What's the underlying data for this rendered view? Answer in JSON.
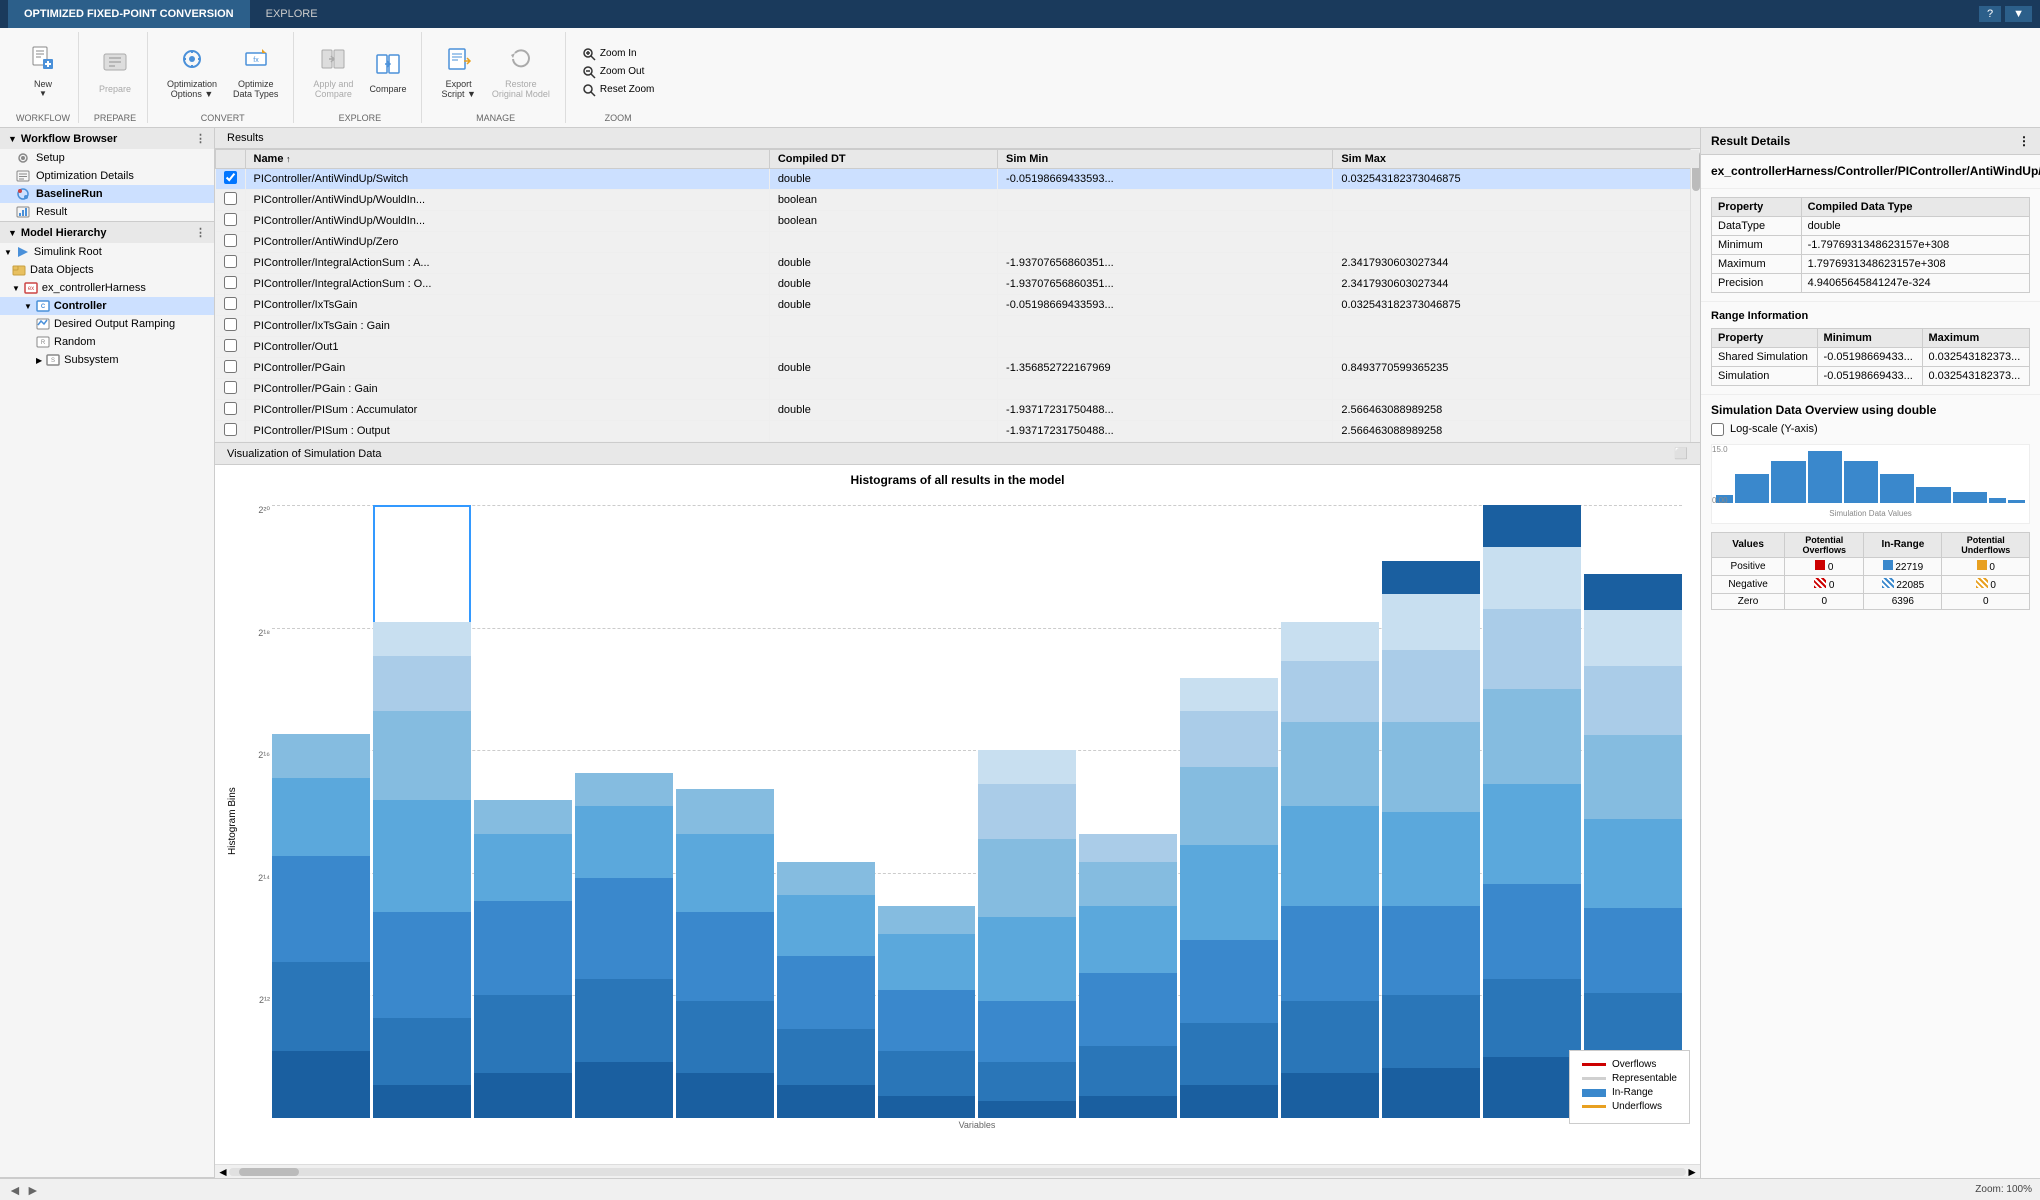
{
  "titleBar": {
    "tabs": [
      {
        "label": "OPTIMIZED FIXED-POINT CONVERSION",
        "active": true
      },
      {
        "label": "EXPLORE",
        "active": false
      }
    ],
    "helpLabel": "?"
  },
  "toolbar": {
    "groups": [
      {
        "label": "WORKFLOW",
        "buttons": [
          {
            "id": "new",
            "icon": "➕",
            "label": "New",
            "dropdown": true,
            "disabled": false
          }
        ]
      },
      {
        "label": "PREPARE",
        "buttons": [
          {
            "id": "prepare",
            "icon": "📋",
            "label": "Prepare",
            "disabled": true
          }
        ]
      },
      {
        "label": "CONVERT",
        "buttons": [
          {
            "id": "opt-options",
            "icon": "⚙",
            "label": "Optimization\nOptions",
            "dropdown": true,
            "disabled": false
          },
          {
            "id": "optimize-dt",
            "icon": "🔧",
            "label": "Optimize\nData Types",
            "disabled": false
          }
        ]
      },
      {
        "label": "EXPLORE",
        "buttons": [
          {
            "id": "apply-compare",
            "icon": "◀",
            "label": "Apply and\nCompare",
            "disabled": false
          },
          {
            "id": "compare",
            "icon": "📊",
            "label": "Compare",
            "disabled": false
          }
        ]
      },
      {
        "label": "MANAGE",
        "buttons": [
          {
            "id": "export-script",
            "icon": "📤",
            "label": "Export\nScript",
            "dropdown": true,
            "disabled": false
          },
          {
            "id": "restore",
            "icon": "↩",
            "label": "Restore\nOriginal Model",
            "disabled": true
          }
        ]
      },
      {
        "label": "ZOOM",
        "buttons": [
          {
            "id": "zoom-in",
            "icon": "🔍",
            "label": "Zoom In",
            "small": true
          },
          {
            "id": "zoom-out",
            "icon": "🔍",
            "label": "Zoom Out",
            "small": true
          },
          {
            "id": "reset-zoom",
            "icon": "🔍",
            "label": "Reset Zoom",
            "small": true
          }
        ]
      }
    ]
  },
  "sidebar": {
    "workflowBrowser": {
      "title": "Workflow Browser",
      "items": [
        {
          "label": "Setup",
          "icon": "⚙",
          "type": "step"
        },
        {
          "label": "Optimization Details",
          "icon": "📋",
          "type": "step",
          "selected": false
        },
        {
          "label": "BaselineRun",
          "icon": "🔧",
          "type": "step",
          "selected": true
        },
        {
          "label": "Result",
          "icon": "📊",
          "type": "step"
        }
      ]
    },
    "modelHierarchy": {
      "title": "Model Hierarchy",
      "items": [
        {
          "label": "Simulink Root",
          "icon": "▶",
          "indent": 0,
          "expand": true
        },
        {
          "label": "Data Objects",
          "icon": "📁",
          "indent": 1
        },
        {
          "label": "ex_controllerHarness",
          "icon": "📄",
          "indent": 1,
          "expand": true
        },
        {
          "label": "Controller",
          "icon": "📦",
          "indent": 2,
          "expand": true,
          "selected": true
        },
        {
          "label": "Desired Output Ramping",
          "icon": "📄",
          "indent": 3
        },
        {
          "label": "Random",
          "icon": "📄",
          "indent": 3
        },
        {
          "label": "Subsystem",
          "icon": "📦",
          "indent": 3,
          "expand": false
        }
      ]
    }
  },
  "results": {
    "tabLabel": "Results",
    "columns": [
      "Name",
      "Compiled DT",
      "Sim Min",
      "Sim Max"
    ],
    "rows": [
      {
        "name": "PIController/AntiWindUp/Switch",
        "compiledDT": "double",
        "simMin": "-0.05198669433593...",
        "simMax": "0.032543182373046875",
        "selected": true
      },
      {
        "name": "PIController/AntiWindUp/WouldIn...",
        "compiledDT": "boolean",
        "simMin": "",
        "simMax": ""
      },
      {
        "name": "PIController/AntiWindUp/WouldIn...",
        "compiledDT": "boolean",
        "simMin": "",
        "simMax": ""
      },
      {
        "name": "PIController/AntiWindUp/Zero",
        "compiledDT": "",
        "simMin": "",
        "simMax": ""
      },
      {
        "name": "PIController/IntegralActionSum : A...",
        "compiledDT": "double",
        "simMin": "-1.93707656860351...",
        "simMax": "2.3417930603027344"
      },
      {
        "name": "PIController/IntegralActionSum : O...",
        "compiledDT": "double",
        "simMin": "-1.93707656860351...",
        "simMax": "2.3417930603027344"
      },
      {
        "name": "PIController/IxTsGain",
        "compiledDT": "double",
        "simMin": "-0.05198669433593...",
        "simMax": "0.032543182373046875"
      },
      {
        "name": "PIController/IxTsGain : Gain",
        "compiledDT": "",
        "simMin": "",
        "simMax": ""
      },
      {
        "name": "PIController/Out1",
        "compiledDT": "",
        "simMin": "",
        "simMax": ""
      },
      {
        "name": "PIController/PGain",
        "compiledDT": "double",
        "simMin": "-1.356852722167969",
        "simMax": "0.8493770599365235"
      },
      {
        "name": "PIController/PGain : Gain",
        "compiledDT": "",
        "simMin": "",
        "simMax": ""
      },
      {
        "name": "PIController/PISum : Accumulator",
        "compiledDT": "double",
        "simMin": "-1.93717231750488...",
        "simMax": "2.566463088989258"
      },
      {
        "name": "PIController/PISum : Output",
        "compiledDT": "",
        "simMin": "-1.93717231750488...",
        "simMax": "2.566463088989258"
      }
    ]
  },
  "visualization": {
    "tabLabel": "Visualization of Simulation Data",
    "chartTitle": "Histograms of all results in the model",
    "yAxisLabel": "Histogram Bins",
    "legend": {
      "items": [
        {
          "label": "Overflows",
          "type": "overflow"
        },
        {
          "label": "Representable",
          "type": "representable"
        },
        {
          "label": "In-Range",
          "type": "in-range"
        },
        {
          "label": "Underflows",
          "type": "underflow"
        }
      ]
    },
    "bars": [
      {
        "heights": [
          0.3,
          0.5,
          0.6,
          0.4,
          0.2
        ],
        "selected": false
      },
      {
        "heights": [
          0.2,
          0.4,
          0.7,
          0.8,
          0.6,
          0.4
        ],
        "selected": true
      },
      {
        "heights": [
          0.3,
          0.6,
          0.8,
          0.5,
          0.3
        ],
        "selected": false
      },
      {
        "heights": [
          0.4,
          0.7,
          0.9,
          0.6,
          0.2
        ],
        "selected": false
      },
      {
        "heights": [
          0.5,
          0.6,
          0.8,
          0.7,
          0.4
        ],
        "selected": false
      },
      {
        "heights": [
          0.3,
          0.5,
          0.7,
          0.6,
          0.3
        ],
        "selected": false
      },
      {
        "heights": [
          0.2,
          0.4,
          0.6,
          0.5,
          0.2
        ],
        "selected": false
      },
      {
        "heights": [
          0.1,
          0.3,
          0.5,
          0.8,
          0.7,
          0.5
        ],
        "selected": false
      },
      {
        "heights": [
          0.2,
          0.5,
          0.7,
          0.6,
          0.4,
          0.3
        ],
        "selected": false
      },
      {
        "heights": [
          0.3,
          0.6,
          0.8,
          0.9,
          0.7,
          0.5,
          0.3
        ],
        "selected": false
      },
      {
        "heights": [
          0.4,
          0.7,
          0.9,
          0.95,
          0.8,
          0.6,
          0.4
        ],
        "selected": false
      },
      {
        "heights": [
          0.5,
          0.7,
          0.85,
          0.9,
          0.85,
          0.7,
          0.5,
          0.3
        ],
        "selected": false
      },
      {
        "heights": [
          0.6,
          0.75,
          0.9,
          0.95,
          0.9,
          0.75,
          0.6,
          0.4
        ],
        "selected": false
      },
      {
        "heights": [
          0.5,
          0.65,
          0.8,
          0.85,
          0.8,
          0.65,
          0.5,
          0.35
        ],
        "selected": false
      }
    ]
  },
  "statusBar": {
    "zoomLabel": "Zoom: 100%"
  },
  "rightPanel": {
    "header": "Result Details",
    "title": "ex_controllerHarness/Controller/PIController/AntiWindUp/Switch",
    "properties": {
      "sectionTitle": "",
      "headers": [
        "Property",
        "Compiled Data Type"
      ],
      "rows": [
        {
          "property": "DataType",
          "value": "double"
        },
        {
          "property": "Minimum",
          "value": "-1.7976931348623157e+308"
        },
        {
          "property": "Maximum",
          "value": "1.7976931348623157e+308"
        },
        {
          "property": "Precision",
          "value": "4.94065645841247e-324"
        }
      ]
    },
    "rangeInfo": {
      "title": "Range Information",
      "headers": [
        "Property",
        "Minimum",
        "Maximum"
      ],
      "rows": [
        {
          "property": "Shared Simulation",
          "min": "-0.05198669433...",
          "max": "0.032543182373..."
        },
        {
          "property": "Simulation",
          "min": "-0.05198669433...",
          "max": "0.032543182373..."
        }
      ]
    },
    "simOverview": {
      "title": "Simulation Data Overview using double",
      "logScaleLabel": "Log-scale (Y-axis)",
      "miniBarHeights": [
        10,
        35,
        55,
        70,
        55,
        35,
        20,
        10,
        5,
        5
      ],
      "tableHeaders": [
        "Values",
        "Potential Overflows",
        "In-Range",
        "Potential Underflows"
      ],
      "rows": [
        {
          "label": "Positive",
          "overflows": "0",
          "inRange": "22719",
          "underflows": "0"
        },
        {
          "label": "Negative",
          "overflows": "0",
          "inRange": "22085",
          "underflows": "0"
        },
        {
          "label": "Zero",
          "overflows": "0",
          "inRange": "6396",
          "underflows": "0"
        }
      ]
    }
  }
}
